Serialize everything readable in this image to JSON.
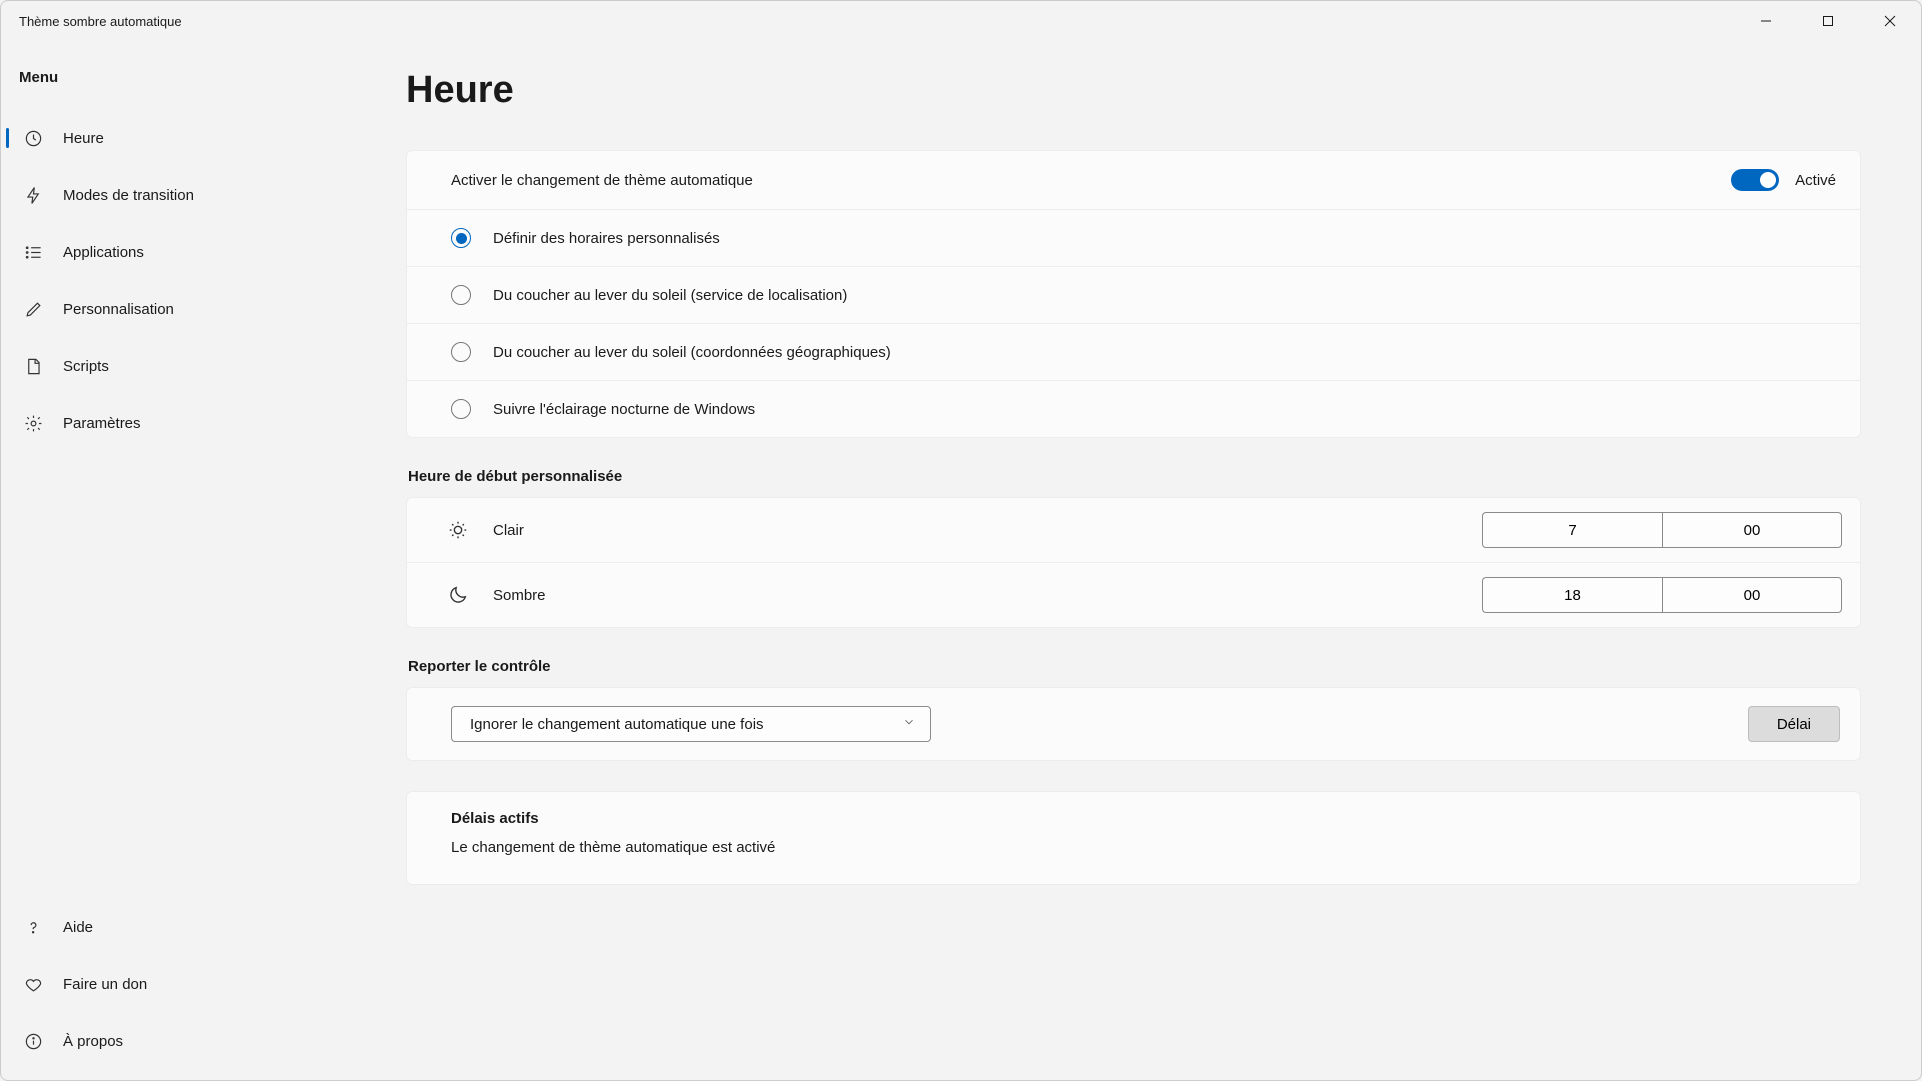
{
  "window": {
    "title": "Thème sombre automatique"
  },
  "sidebar": {
    "heading": "Menu",
    "items": [
      {
        "label": "Heure",
        "icon": "clock-icon",
        "active": true
      },
      {
        "label": "Modes de transition",
        "icon": "lightning-icon"
      },
      {
        "label": "Applications",
        "icon": "list-icon"
      },
      {
        "label": "Personnalisation",
        "icon": "pencil-icon"
      },
      {
        "label": "Scripts",
        "icon": "document-icon"
      },
      {
        "label": "Paramètres",
        "icon": "gear-icon"
      }
    ],
    "footer": [
      {
        "label": "Aide",
        "icon": "help-icon"
      },
      {
        "label": "Faire un don",
        "icon": "heart-icon"
      },
      {
        "label": "À propos",
        "icon": "info-icon"
      }
    ]
  },
  "page": {
    "title": "Heure",
    "auto_switch": {
      "label": "Activer le changement de thème automatique",
      "state_label": "Activé",
      "enabled": true
    },
    "schedule_options": [
      {
        "label": "Définir des horaires personnalisés",
        "selected": true
      },
      {
        "label": "Du coucher au lever du soleil (service de localisation)",
        "selected": false
      },
      {
        "label": "Du coucher au lever du soleil (coordonnées géographiques)",
        "selected": false
      },
      {
        "label": "Suivre l'éclairage nocturne de Windows",
        "selected": false
      }
    ],
    "custom_start": {
      "heading": "Heure de début personnalisée",
      "light": {
        "label": "Clair",
        "hour": "7",
        "minute": "00"
      },
      "dark": {
        "label": "Sombre",
        "hour": "18",
        "minute": "00"
      }
    },
    "postpone": {
      "heading": "Reporter le contrôle",
      "select_value": "Ignorer le changement automatique une fois",
      "button": "Délai"
    },
    "active_delays": {
      "heading": "Délais actifs",
      "text": "Le changement de thème automatique est activé"
    }
  }
}
